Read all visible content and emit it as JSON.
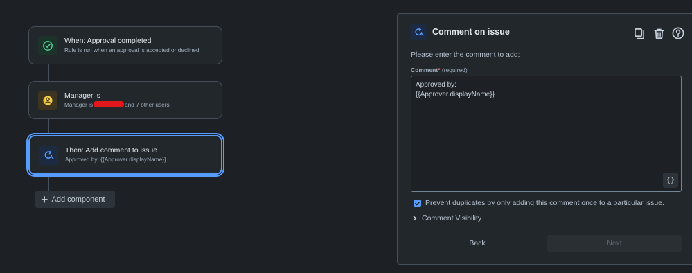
{
  "flow": {
    "trigger": {
      "title": "When: Approval completed",
      "subtitle": "Rule is run when an approval is accepted or declined",
      "icon": "check-circle-icon"
    },
    "condition": {
      "title": "Manager is",
      "subtitle_prefix": "Manager is",
      "subtitle_suffix": "and 7 other users",
      "icon": "user-circle-icon"
    },
    "action": {
      "title": "Then: Add comment to issue",
      "subtitle": "Approved by: {{Approver.displayName}}",
      "icon": "comment-refresh-icon"
    },
    "add_component_label": "Add component"
  },
  "panel": {
    "title": "Comment on issue",
    "prompt": "Please enter the comment to add:",
    "field_label": "Comment",
    "required_marker": "*",
    "required_text": "(required)",
    "comment_value": "Approved by:\n{{Approver.displayName}}",
    "variables_button": "{}",
    "prevent_duplicates_checked": true,
    "prevent_duplicates_label": "Prevent duplicates by only adding this comment once to a particular issue.",
    "visibility_label": "Comment Visibility",
    "back_label": "Back",
    "next_label": "Next"
  },
  "colors": {
    "background": "#1d2125",
    "accent": "#579dff",
    "success": "#4bce97",
    "warning": "#f5cd47"
  }
}
